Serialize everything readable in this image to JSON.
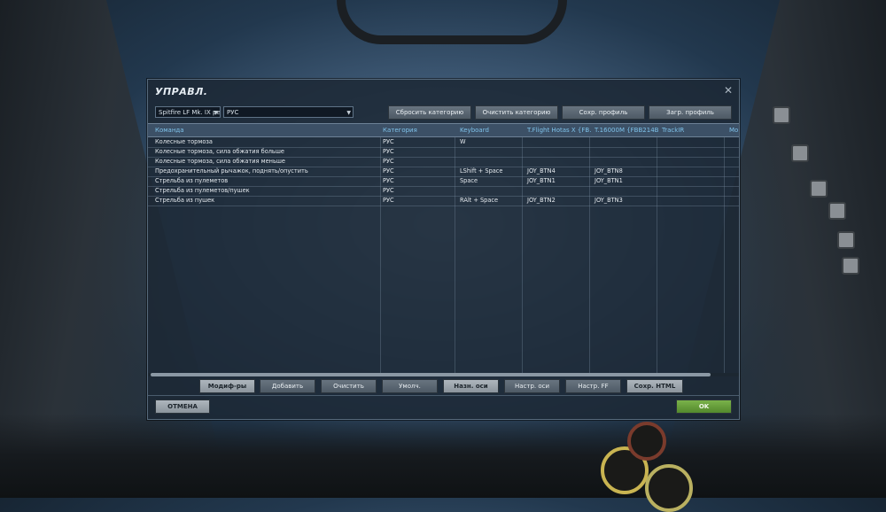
{
  "dialog": {
    "title": "УПРАВЛ.",
    "close_icon": "close-icon"
  },
  "selectors": {
    "aircraft": "Spitfire LF Mk. IX ре",
    "category": "РУС"
  },
  "top_buttons": {
    "reset_category": "Сбросить категорию",
    "clear_category": "Очистить категорию",
    "save_profile": "Сохр. профиль",
    "load_profile": "Загр. профиль"
  },
  "table": {
    "columns": [
      "Команда",
      "Категория",
      "Keyboard",
      "T.Flight Hotas X {FB...",
      "T.16000M {FBB214B...",
      "TrackIR",
      "Mo"
    ],
    "rows": [
      [
        "Колесные тормоза",
        "РУС",
        "W",
        "",
        "",
        ""
      ],
      [
        "Колесные тормоза, сила обжатия больше",
        "РУС",
        "",
        "",
        "",
        ""
      ],
      [
        "Колесные тормоза, сила обжатия меньше",
        "РУС",
        "",
        "",
        "",
        ""
      ],
      [
        "Предохранительный рычажок, поднять/опустить",
        "РУС",
        "LShift + Space",
        "JOY_BTN4",
        "JOY_BTN8",
        ""
      ],
      [
        "Стрельба из пулеметов",
        "РУС",
        "Space",
        "JOY_BTN1",
        "JOY_BTN1",
        ""
      ],
      [
        "Стрельба из пулеметов/пушек",
        "РУС",
        "",
        "",
        "",
        ""
      ],
      [
        "Стрельба из пушек",
        "РУС",
        "RAlt + Space",
        "JOY_BTN2",
        "JOY_BTN3",
        ""
      ]
    ]
  },
  "bottom_buttons": {
    "modifiers": "Модиф-ры",
    "add": "Добавить",
    "clear": "Очистить",
    "default": "Умолч.",
    "assign_axes": "Назн. оси",
    "axis_tune": "Настр. оси",
    "ff_tune": "Настр. FF",
    "save_html": "Сохр. HTML"
  },
  "footer": {
    "cancel": "ОТМЕНА",
    "ok": "OK"
  },
  "colors": {
    "header_text": "#7fc2ea",
    "ok_green": "#6aa13c",
    "dialog_bg": "#1c2834"
  }
}
